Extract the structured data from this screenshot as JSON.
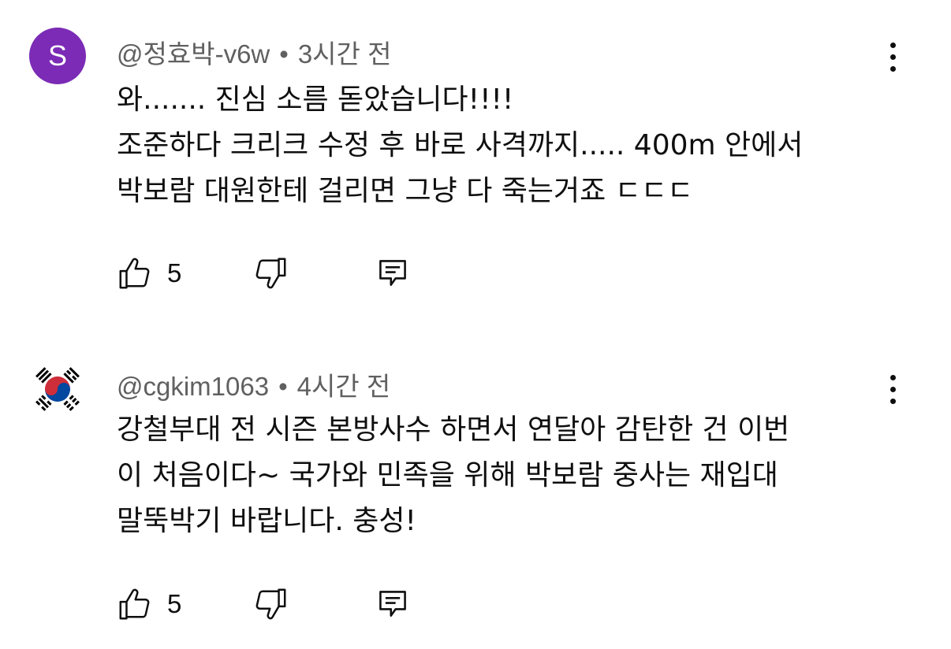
{
  "comments": [
    {
      "avatar_letter": "S",
      "author": "@정효박-v6w",
      "separator": "•",
      "time": "3시간 전",
      "lines": [
        "와....... 진심 소름 돋았습니다!!!!",
        "조준하다 크리크 수정 후 바로 사격까지..... 400m 안에서",
        "박보람 대원한테 걸리면 그냥 다 죽는거죠 ㄷㄷㄷ"
      ],
      "likes": "5"
    },
    {
      "author": "@cgkim1063",
      "separator": "•",
      "time": "4시간 전",
      "lines": [
        "강철부대 전 시즌 본방사수 하면서 연달아 감탄한 건 이번",
        "이 처음이다~ 국가와 민족을 위해 박보람 중사는 재입대",
        "말뚝박기 바랍니다. 충성!"
      ],
      "likes": "5"
    }
  ],
  "colors": {
    "avatar_bg": "#7b2bb5",
    "meta_text": "#606060",
    "text": "#0f0f0f"
  }
}
